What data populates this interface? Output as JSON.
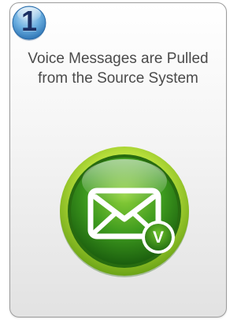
{
  "step": {
    "number": "1"
  },
  "caption": {
    "line1": "Voice Messages are Pulled",
    "line2": "from the Source System"
  },
  "icon": {
    "name": "voicemail-envelope-icon",
    "badge_letter": "V"
  },
  "colors": {
    "badge_blue": "#5aa0d6",
    "badge_text": "#1b2f63",
    "icon_green": "#3d9a1e",
    "icon_green_light": "#b6de3a",
    "card_border": "#9c9c9c"
  }
}
